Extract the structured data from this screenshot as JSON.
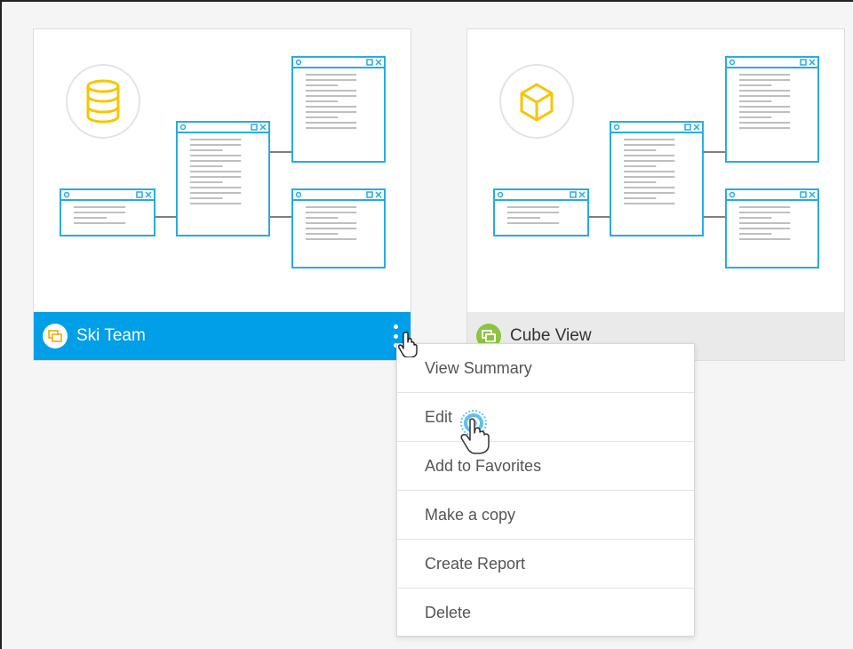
{
  "cards": [
    {
      "title": "Ski Team",
      "icon": "database-icon",
      "badge_icon": "view-icon",
      "selected": true
    },
    {
      "title": "Cube View",
      "icon": "cube-icon",
      "badge_icon": "view-icon",
      "selected": false
    }
  ],
  "context_menu": {
    "items": [
      {
        "label": "View Summary"
      },
      {
        "label": "Edit"
      },
      {
        "label": "Add to Favorites"
      },
      {
        "label": "Make a copy"
      },
      {
        "label": "Create Report"
      },
      {
        "label": "Delete"
      }
    ]
  },
  "colors": {
    "selected_footer": "#009fe8",
    "footer": "#eaeaea",
    "diagram_blue": "#29abe2",
    "icon_yellow": "#f7c500",
    "badge_green": "#8cc43f"
  }
}
